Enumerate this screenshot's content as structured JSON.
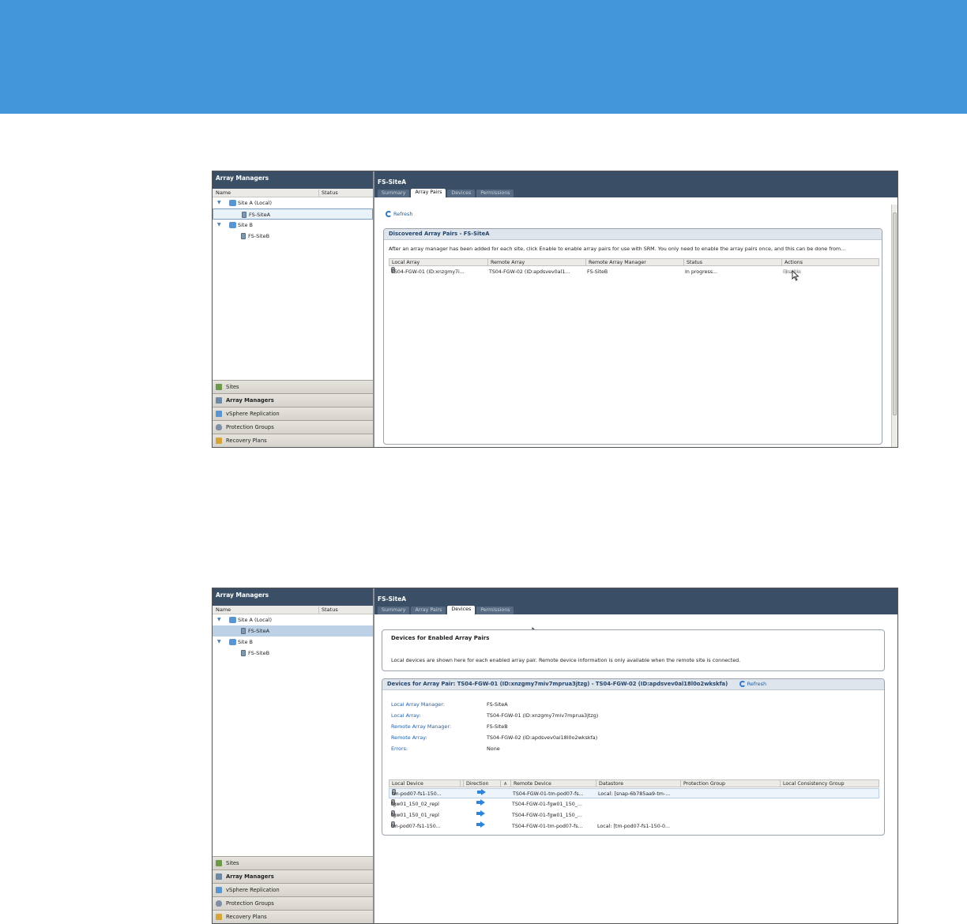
{
  "colors": {
    "header_band": "#4396d8",
    "panel_header": "#3a4f66",
    "link": "#1f5fa8"
  },
  "screens": [
    {
      "left": {
        "title": "Array Managers",
        "col_name": "Name",
        "col_status": "Status",
        "tree": [
          "Site A (Local)",
          "FS-SiteA",
          "Site B",
          "FS-SiteB"
        ]
      },
      "nav": [
        "Sites",
        "Array Managers",
        "vSphere Replication",
        "Protection Groups",
        "Recovery Plans"
      ],
      "right": {
        "title": "FS-SiteA",
        "tabs": [
          "Summary",
          "Array Pairs",
          "Devices",
          "Permissions"
        ],
        "active_tab": "Array Pairs",
        "refresh": "Refresh",
        "panel_title": "Discovered Array Pairs - FS-SiteA",
        "panel_desc": "After an array manager has been added for each site, click Enable to enable array pairs for use with SRM. You only need to enable the array pairs once, and this can be done from...",
        "headers": [
          "Local Array",
          "Remote Array",
          "Remote Array Manager",
          "Status",
          "Actions"
        ],
        "row": [
          "TS04-FGW-01 (ID:xnzgmy7i...",
          "TS04-FGW-02 (ID:apdsvev0al1...",
          "FS-SiteB",
          "In progress..."
        ],
        "action_enable": "Enable",
        "action_sep": "|",
        "action_disable": "Disable"
      }
    },
    {
      "left": {
        "title": "Array Managers",
        "col_name": "Name",
        "col_status": "Status",
        "tree": [
          "Site A (Local)",
          "FS-SiteA",
          "Site B",
          "FS-SiteB"
        ]
      },
      "nav": [
        "Sites",
        "Array Managers",
        "vSphere Replication",
        "Protection Groups",
        "Recovery Plans"
      ],
      "right": {
        "title": "FS-SiteA",
        "tabs": [
          "Summary",
          "Array Pairs",
          "Devices",
          "Permissions"
        ],
        "active_tab": "Devices",
        "info_title": "Devices for Enabled Array Pairs",
        "info_desc": "Local devices are shown here for each enabled array pair. Remote device information is only available when the remote site is connected.",
        "pair_title": "Devices for Array Pair: TS04-FGW-01 (ID:xnzgmy7miv7mprua3jtzg) - TS04-FGW-02 (ID:apdsvev0al18l0o2wkskfa)",
        "refresh": "Refresh",
        "props": [
          {
            "k": "Local Array Manager:",
            "v": "FS-SiteA"
          },
          {
            "k": "Local Array:",
            "v": "TS04-FGW-01 (ID:xnzgmy7miv7mprua3jtzg)"
          },
          {
            "k": "Remote Array Manager:",
            "v": "FS-SiteB"
          },
          {
            "k": "Remote Array:",
            "v": "TS04-FGW-02 (ID:apdsvev0al18l0o2wkskfa)"
          },
          {
            "k": "Errors:",
            "v": "None"
          }
        ],
        "headers": [
          "Local Device",
          "Direction",
          "Remote Device",
          "Datastore",
          "Protection Group",
          "Local Consistency Group"
        ],
        "sort_indicator": "∧",
        "rows": [
          [
            "tm-pod07-fs1-150...",
            "TS04-FGW-01-tm-pod07-fs...",
            "Local: [snap-6b785aa9-tm-..."
          ],
          [
            "fgw01_150_02_repl",
            "TS04-FGW-01-fgw01_150_...",
            ""
          ],
          [
            "fgw01_150_01_repl",
            "TS04-FGW-01-fgw01_150_...",
            ""
          ],
          [
            "tm-pod07-fs1-150...",
            "TS04-FGW-01-tm-pod07-fs...",
            "Local: [tm-pod07-fs1-150-0..."
          ]
        ]
      }
    }
  ]
}
